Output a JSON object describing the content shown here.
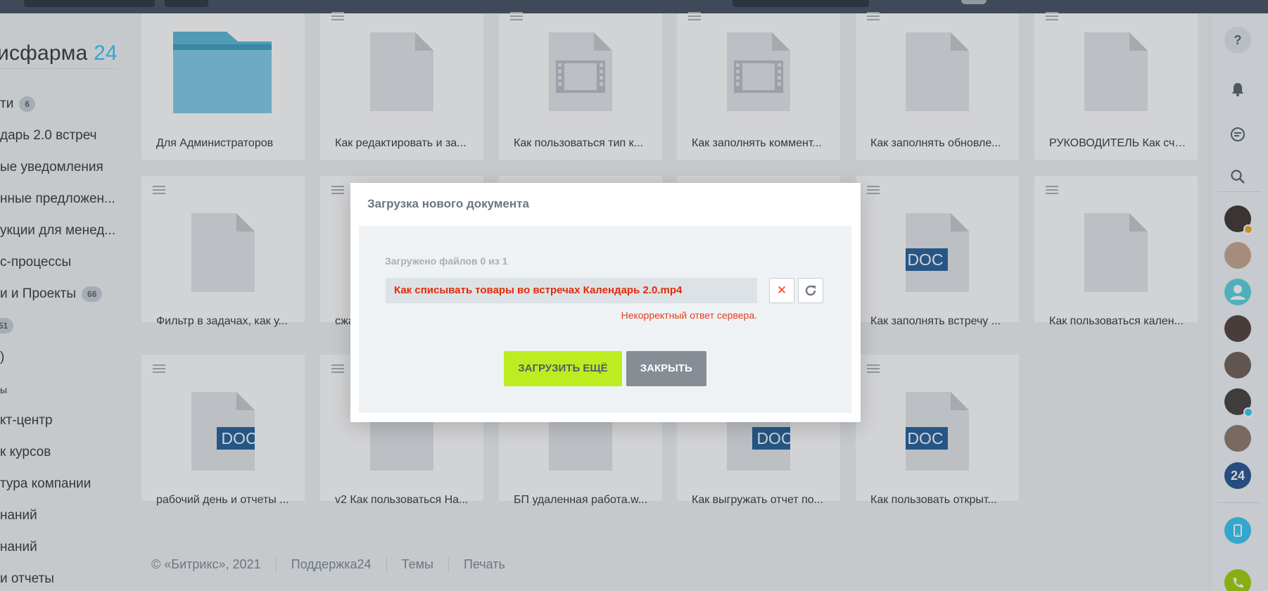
{
  "sidebar": {
    "logo_text": "исфарма",
    "logo_number": "24",
    "items": [
      {
        "label": "ти",
        "counter": "6"
      },
      {
        "label": "дарь 2.0 встреч",
        "counter": ""
      },
      {
        "label": "ые уведомления",
        "counter": ""
      },
      {
        "label": "нные предложен...",
        "counter": ""
      },
      {
        "label": "укции для менед...",
        "counter": ""
      },
      {
        "label": "с-процессы",
        "counter": ""
      },
      {
        "label": "и и Проекты",
        "counter": "66"
      },
      {
        "label": "",
        "counter": "51"
      },
      {
        "label": ")",
        "counter": ""
      },
      {
        "label": "ы",
        "counter": ""
      },
      {
        "label": "кт-центр",
        "counter": ""
      },
      {
        "label": "к курсов",
        "counter": ""
      },
      {
        "label": "тура компании",
        "counter": ""
      },
      {
        "label": "наний",
        "counter": ""
      },
      {
        "label": "наний",
        "counter": ""
      },
      {
        "label": " и отчеты",
        "counter": ""
      }
    ]
  },
  "files": [
    {
      "name": "Для Администраторов",
      "type": "folder"
    },
    {
      "name": "Как редактировать и за...",
      "type": "file"
    },
    {
      "name": "Как пользоваться тип к...",
      "type": "video"
    },
    {
      "name": "Как заполнять коммент...",
      "type": "video"
    },
    {
      "name": "Как заполнять обновле...",
      "type": "file"
    },
    {
      "name": "РУКОВОДИТЕЛЬ Как счи...",
      "type": "file"
    },
    {
      "name": "Фильтр в задачах, как у...",
      "type": "file"
    },
    {
      "name": "сжа",
      "type": "file"
    },
    {
      "name": "",
      "type": "file"
    },
    {
      "name": "",
      "type": "file"
    },
    {
      "name": "Как заполнять встречу ...",
      "type": "doc",
      "badge": "DOC"
    },
    {
      "name": "Как пользоваться кален...",
      "type": "file"
    },
    {
      "name": "рабочий день и отчеты ...",
      "type": "doc",
      "badge": "DOC"
    },
    {
      "name": "v2 Как пользоваться На...",
      "type": "file"
    },
    {
      "name": "БП удаленная работа.w...",
      "type": "file"
    },
    {
      "name": "Как выгружать отчет по...",
      "type": "doc",
      "badge": "DOC"
    },
    {
      "name": "Как пользовать открыт...",
      "type": "doc",
      "badge": "DOC"
    }
  ],
  "footer": {
    "copyright": "© «Битрикс», 2021",
    "links": [
      "Поддержка24",
      "Темы",
      "Печать"
    ]
  },
  "right_panel": {
    "help": "?",
    "b24": "24"
  },
  "modal": {
    "title": "Загрузка нового документа",
    "status": "Загружено файлов 0 из 1",
    "file_name": "Как списывать товары во встречах Календарь 2.0.mp4",
    "error": "Некорректный ответ сервера.",
    "upload_more": "ЗАГРУЗИТЬ ЕЩЁ",
    "close": "ЗАКРЫТЬ"
  },
  "colors": {
    "accent": "#2fc6f6",
    "error": "#e12c0b",
    "upload_button": "#bbed21",
    "close_button": "#868d95",
    "doc_badge": "#1d5b96",
    "folder": "#55b6d6"
  }
}
